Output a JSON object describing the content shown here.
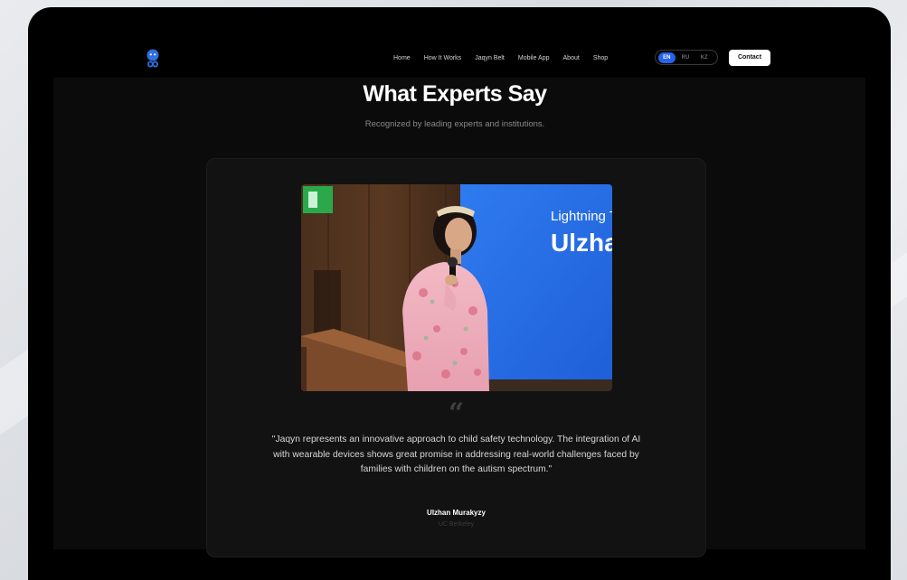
{
  "nav": {
    "links": [
      "Home",
      "How It Works",
      "Jaqyn Belt",
      "Mobile App",
      "About",
      "Shop"
    ],
    "languages": [
      "EN",
      "RU",
      "KZ"
    ],
    "active_language": "EN",
    "contact_label": "Contact"
  },
  "section": {
    "title": "What Experts Say",
    "subtitle": "Recognized by leading experts and institutions."
  },
  "testimonial": {
    "photo_screen_text_1": "Lightning To",
    "photo_screen_text_2": "Ulzha",
    "quote_glyph": "“",
    "quote": "\"Jaqyn represents an innovative approach to child safety technology. The integration of AI with wearable devices shows great promise in addressing real-world challenges faced by families with children on the autism spectrum.\"",
    "author": "Ulzhan Murakyzy",
    "affiliation": "UC Berkeley"
  },
  "colors": {
    "accent": "#2563eb",
    "background": "#0b0b0b",
    "card": "#121212"
  }
}
